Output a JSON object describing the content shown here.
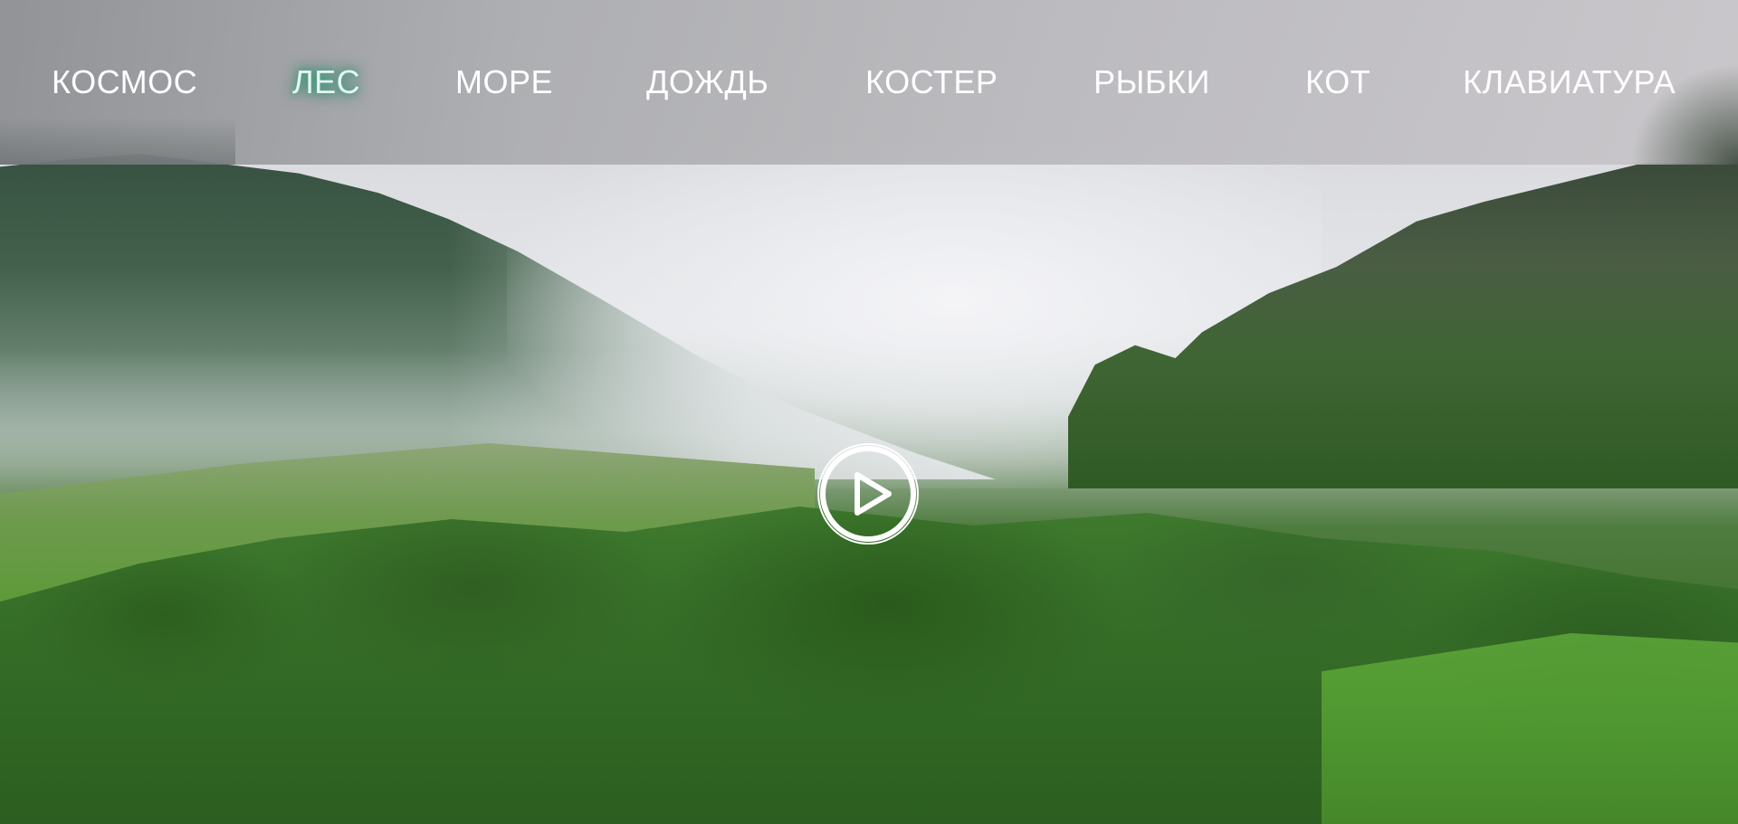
{
  "nav": {
    "items": [
      {
        "label": "КОСМОС",
        "active": false
      },
      {
        "label": "ЛЕС",
        "active": true
      },
      {
        "label": "МОРЕ",
        "active": false
      },
      {
        "label": "ДОЖДЬ",
        "active": false
      },
      {
        "label": "КОСТЕР",
        "active": false
      },
      {
        "label": "РЫБКИ",
        "active": false
      },
      {
        "label": "КОТ",
        "active": false
      },
      {
        "label": "КЛАВИАТУРА",
        "active": false
      }
    ]
  },
  "player": {
    "icon": "play-icon"
  },
  "colors": {
    "nav_text": "#ffffff",
    "active_glow": "#2d8c6e",
    "play_icon": "#ffffff"
  }
}
